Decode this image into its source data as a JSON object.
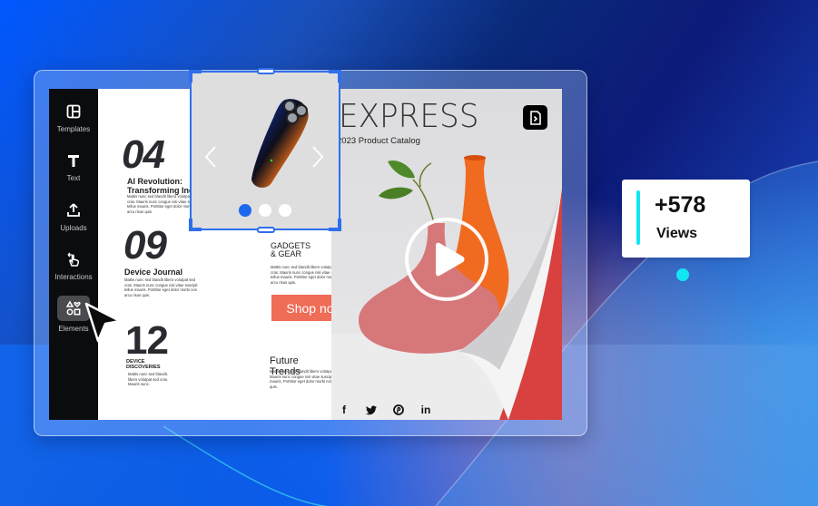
{
  "sidebar": {
    "items": [
      {
        "label": "Templates",
        "icon": "templates-icon"
      },
      {
        "label": "Text",
        "icon": "text-icon"
      },
      {
        "label": "Uploads",
        "icon": "upload-icon"
      },
      {
        "label": "Interactions",
        "icon": "interactions-icon"
      },
      {
        "label": "Elements",
        "icon": "elements-icon",
        "active": true
      }
    ]
  },
  "catalog": {
    "left_page": {
      "sections": [
        {
          "number": "04",
          "title": "AI Revolution: Transforming Industries",
          "title_line1": "AI Revolution:",
          "title_line2": "Transforming Industrie",
          "body": "Mattis nunc sed blandit libero volutpat sed cras. Mauris nunc congue nisi vitae suscipit tellus mauris. Porttitor eget dolor morbi non arcu risus quis."
        },
        {
          "number": "09",
          "title": "Device Journal",
          "body": "Mattis nunc sed blandit libero volutpat sed cras. Mauris nunc congue nisi vitae suscipit tellus mauris. Porttitor eget dolor morbi non arcu risus quis."
        },
        {
          "number": "12",
          "title_line1": "DEVICE",
          "title_line2": "DISCOVERIES",
          "body": "Mattis nunc sed blandit. libero volutpat sed cras. Mauris nunc."
        }
      ],
      "gadgets": {
        "title_line1": "GADGETS",
        "title_line2": "& GEAR",
        "body": "Mattis nunc sed blandit libero volutpat sed cras. Mauris nunc congue nisi vitae suscipit tellus mauris. Porttitor eget dolor morbi non arcu risus quis.",
        "cta_label": "Shop now",
        "cta_color": "#ef6c57"
      },
      "future": {
        "title": "Future Trends",
        "body": "Mattis nunc sed blandit libero volutpat sed cras. Mauris nunc congue nisi vitae suscipit tellus mauris. Porttitor eget dolor morbi non arcu risus quis."
      }
    },
    "right_page": {
      "title": "EXPRESS",
      "subtitle": "2023 Product Catalog",
      "doc_icon": "document-icon",
      "play_icon": "play-icon",
      "socials": [
        "f",
        "twitter",
        "pinterest",
        "in"
      ]
    }
  },
  "carousel": {
    "product": "electric shaver",
    "slides_total": 3,
    "active_slide": 1,
    "prev_icon": "chevron-left-icon",
    "next_icon": "chevron-right-icon"
  },
  "stats": {
    "value": "+578",
    "label": "Views",
    "accent": "#12e6f2"
  },
  "colors": {
    "selection": "#2f6fec",
    "sidebar_bg": "#0b0c0e",
    "active_dot": "#1e68f0"
  }
}
